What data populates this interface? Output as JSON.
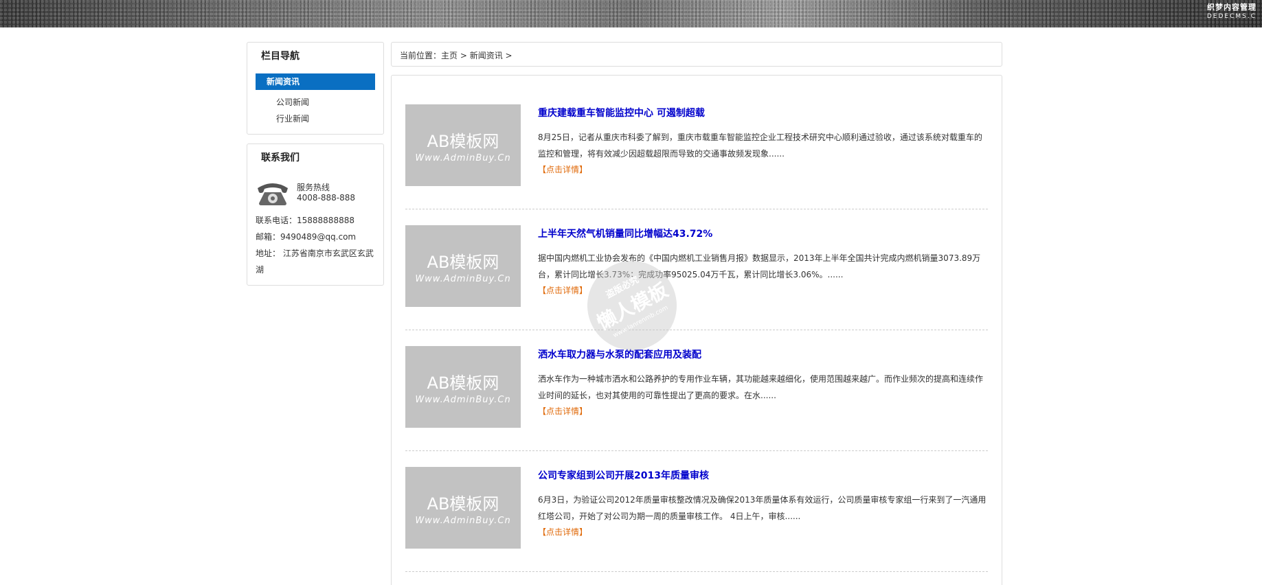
{
  "banner": {
    "logo_line1": "织梦内容管理",
    "logo_line2": "DEDECMS.C"
  },
  "sidebar": {
    "nav_title": "栏目导航",
    "active_item": "新闻资讯",
    "sub_items": [
      "公司新闻",
      "行业新闻"
    ],
    "contact_title": "联系我们",
    "hotline_label": "服务热线",
    "hotline_number": "4008-888-888",
    "phone_line": "联系电话：15888888888",
    "email_line": "邮箱：9490489@qq.com",
    "address_line": "地址： 江苏省南京市玄武区玄武湖"
  },
  "breadcrumb": {
    "prefix": "当前位置：",
    "home": "主页",
    "sep1": " > ",
    "section": "新闻资讯",
    "sep2": " >"
  },
  "thumbnail": {
    "line1": "AB模板网",
    "line2": "Www.AdminBuy.Cn"
  },
  "more_label": "【点击详情】",
  "articles": [
    {
      "title": "重庆建载重车智能监控中心 可遏制超载",
      "desc": "8月25日，记者从重庆市科委了解到，重庆市载重车智能监控企业工程技术研究中心顺利通过验收，通过该系统对载重车的监控和管理，将有效减少因超载超限而导致的交通事故频发现象......"
    },
    {
      "title": "上半年天然气机销量同比增幅达43.72%",
      "desc": "据中国内燃机工业协会发布的《中国内燃机工业销售月报》数据显示，2013年上半年全国共计完成内燃机销量3073.89万台，累计同比增长3.73%；完成功率95025.04万千瓦，累计同比增长3.06%。......"
    },
    {
      "title": "洒水车取力器与水泵的配套应用及装配",
      "desc": "洒水车作为一种城市洒水和公路养护的专用作业车辆，其功能越来越细化，使用范围越来越广。而作业频次的提高和连续作业时间的延长，也对其使用的可靠性提出了更高的要求。在水......"
    },
    {
      "title": "公司专家组到公司开展2013年质量审核",
      "desc": "6月3日，为验证公司2012年质量审核整改情况及确保2013年质量体系有效运行，公司质量审核专家组一行来到了一汽通用红塔公司，开始了对公司为期一周的质量审核工作。 4日上午，审核......"
    }
  ],
  "watermark": {
    "line1": "盗版必究",
    "line2": "懒人模板",
    "line3": "www.lanrenmb.com"
  }
}
